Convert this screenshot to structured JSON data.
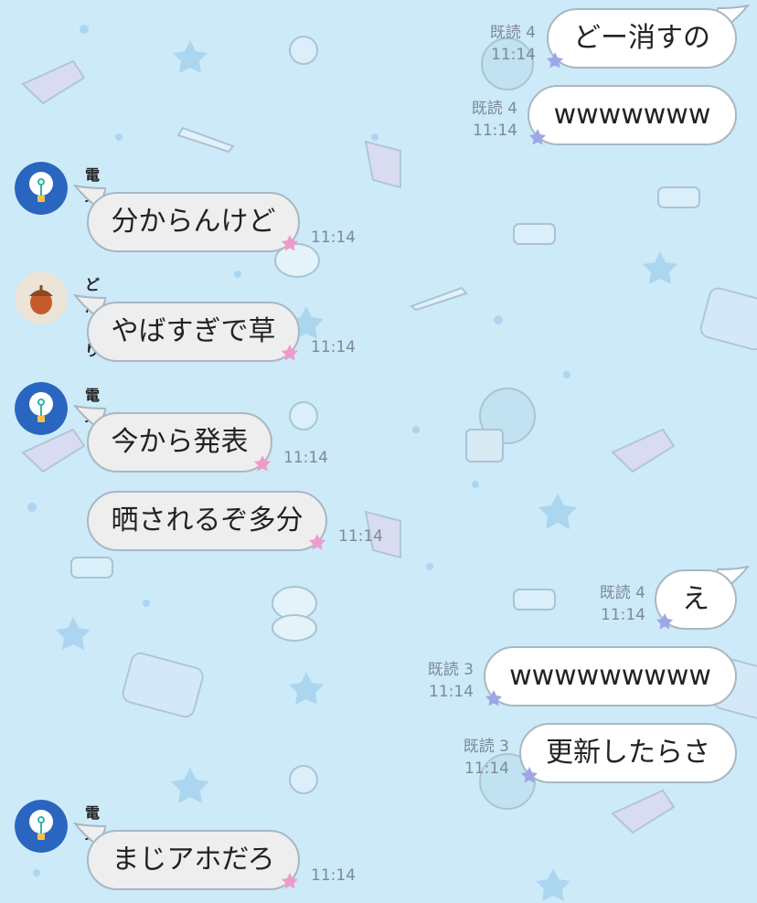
{
  "theme": {
    "background": "#cdeaf9",
    "incoming_bubble": "#eeeeee",
    "outgoing_bubble": "#ffffff",
    "border": "#a9b7c2"
  },
  "messages": [
    {
      "direction": "out",
      "text": "どー消すの",
      "read_label": "既読 4",
      "time": "11:14"
    },
    {
      "direction": "out",
      "text": "wwwwwww",
      "read_label": "既読 4",
      "time": "11:14"
    },
    {
      "direction": "in",
      "sender": "電球",
      "avatar": "lightbulb-avatar",
      "text": "分からんけど",
      "time": "11:14"
    },
    {
      "direction": "in",
      "sender": "どんぐり",
      "avatar": "acorn-avatar",
      "text": "やばすぎで草",
      "time": "11:14"
    },
    {
      "direction": "in",
      "sender": "電球",
      "avatar": "lightbulb-avatar",
      "text": "今から発表",
      "time": "11:14"
    },
    {
      "direction": "in",
      "text": "晒されるぞ多分",
      "time": "11:14"
    },
    {
      "direction": "out",
      "text": "え",
      "read_label": "既読 4",
      "time": "11:14"
    },
    {
      "direction": "out",
      "text": "wwwwwwwww",
      "read_label": "既読 3",
      "time": "11:14"
    },
    {
      "direction": "out",
      "text": "更新したらさ",
      "read_label": "既読 3",
      "time": "11:14"
    },
    {
      "direction": "in",
      "sender": "電球",
      "avatar": "lightbulb-avatar",
      "text": "まじアホだろ",
      "time": "11:14"
    }
  ]
}
